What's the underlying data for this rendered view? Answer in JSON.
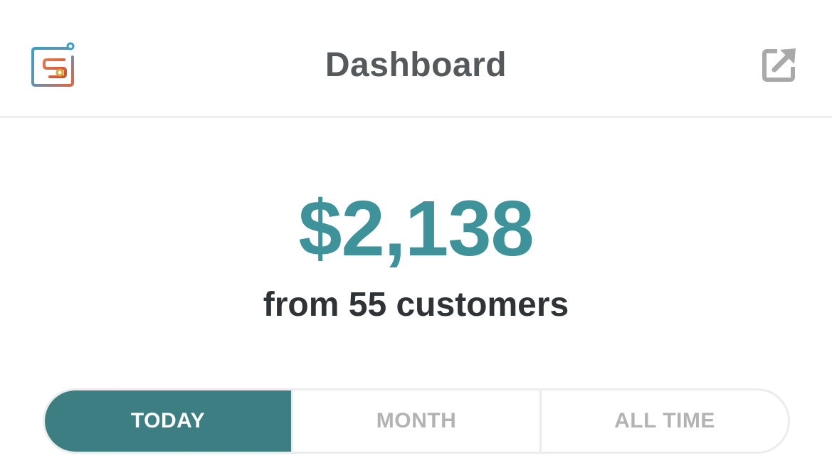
{
  "header": {
    "title": "Dashboard",
    "logo_icon": "app-logo-icon",
    "share_icon": "external-share-icon"
  },
  "summary": {
    "amount": "$2,138",
    "customers_text": "from 55 customers"
  },
  "period_tabs": [
    {
      "label": "TODAY",
      "selected": true
    },
    {
      "label": "MONTH",
      "selected": false
    },
    {
      "label": "ALL TIME",
      "selected": false
    }
  ],
  "colors": {
    "accent": "#3d9399",
    "active_tab": "#3d7e82",
    "title_text": "#55595c",
    "inactive_tab_text": "#b3b3b3"
  }
}
